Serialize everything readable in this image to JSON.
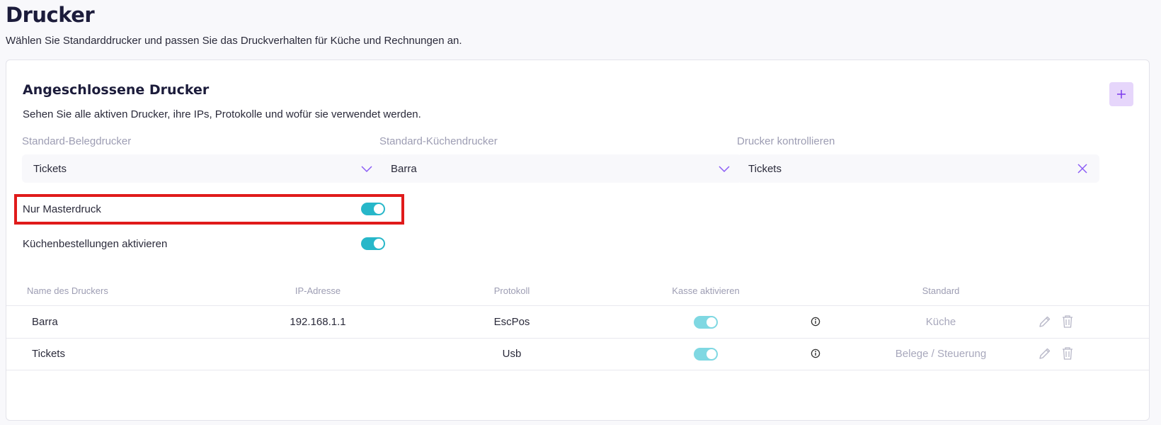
{
  "page": {
    "title": "Drucker",
    "subtitle": "Wählen Sie Standarddrucker und passen Sie das Druckverhalten für Küche und Rechnungen an."
  },
  "card": {
    "title": "Angeschlossene Drucker",
    "subtitle": "Sehen Sie alle aktiven Drucker, ihre IPs, Protokolle und wofür sie verwendet werden.",
    "add_icon": "plus-icon"
  },
  "fields": {
    "receipt_printer": {
      "label": "Standard-Belegdrucker",
      "value": "Tickets",
      "icon": "chevron-down-icon"
    },
    "kitchen_printer": {
      "label": "Standard-Küchendrucker",
      "value": "Barra",
      "icon": "chevron-down-icon"
    },
    "control_printer": {
      "label": "Drucker kontrollieren",
      "value": "Tickets",
      "icon": "close-icon"
    }
  },
  "toggles": {
    "master_print": {
      "label": "Nur Masterdruck",
      "on": true
    },
    "kitchen_orders": {
      "label": "Küchenbestellungen aktivieren",
      "on": true
    }
  },
  "table": {
    "headers": {
      "name": "Name des Druckers",
      "ip": "IP-Adresse",
      "protocol": "Protokoll",
      "cash": "Kasse aktivieren",
      "standard": "Standard"
    },
    "rows": [
      {
        "name": "Barra",
        "ip": "192.168.1.1",
        "protocol": "EscPos",
        "cash_enabled": true,
        "standard": "Küche"
      },
      {
        "name": "Tickets",
        "ip": "",
        "protocol": "Usb",
        "cash_enabled": true,
        "standard": "Belege / Steuerung"
      }
    ]
  },
  "colors": {
    "accent": "#8b5cf6",
    "toggle": "#27b7c9",
    "highlight": "#e01b1b"
  }
}
